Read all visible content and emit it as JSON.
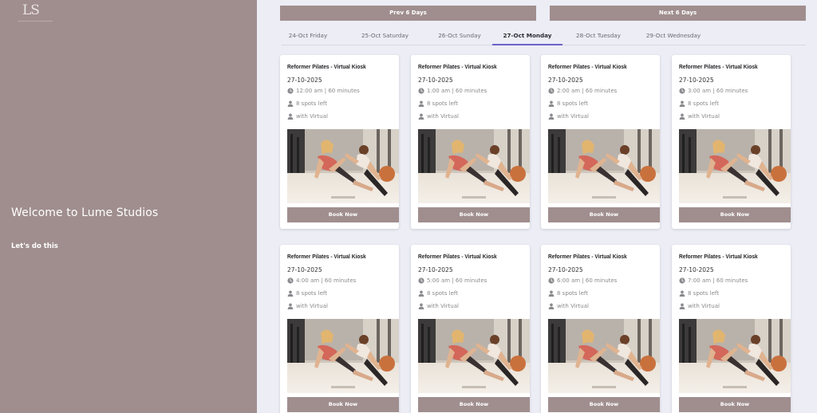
{
  "brand": {
    "logo_text": "LS"
  },
  "left": {
    "welcome": "Welcome to Lume Studios",
    "tagline": "Let's do this"
  },
  "nav": {
    "prev_label": "Prev 6 Days",
    "next_label": "Next 6 Days"
  },
  "tabs": [
    {
      "label": "24-Oct Friday",
      "active": false
    },
    {
      "label": "25-Oct Saturday",
      "active": false
    },
    {
      "label": "26-Oct Sunday",
      "active": false
    },
    {
      "label": "27-Oct Monday",
      "active": true
    },
    {
      "label": "28-Oct Tuesday",
      "active": false
    },
    {
      "label": "29-Oct Wednesday",
      "active": false
    }
  ],
  "classes": [
    {
      "title": "Reformer Pilates - Virtual Kiosk",
      "date": "27-10-2025",
      "time": "12:00 am | 60 minutes",
      "spots": "8 spots left",
      "instructor": "with Virtual",
      "button": "Book Now"
    },
    {
      "title": "Reformer Pilates - Virtual Kiosk",
      "date": "27-10-2025",
      "time": "1:00 am | 60 minutes",
      "spots": "8 spots left",
      "instructor": "with Virtual",
      "button": "Book Now"
    },
    {
      "title": "Reformer Pilates - Virtual Kiosk",
      "date": "27-10-2025",
      "time": "2:00 am | 60 minutes",
      "spots": "8 spots left",
      "instructor": "with Virtual",
      "button": "Book Now"
    },
    {
      "title": "Reformer Pilates - Virtual Kiosk",
      "date": "27-10-2025",
      "time": "3:00 am | 60 minutes",
      "spots": "8 spots left",
      "instructor": "with Virtual",
      "button": "Book Now"
    },
    {
      "title": "Reformer Pilates - Virtual Kiosk",
      "date": "27-10-2025",
      "time": "4:00 am | 60 minutes",
      "spots": "8 spots left",
      "instructor": "with Virtual",
      "button": "Book Now"
    },
    {
      "title": "Reformer Pilates - Virtual Kiosk",
      "date": "27-10-2025",
      "time": "5:00 am | 60 minutes",
      "spots": "8 spots left",
      "instructor": "with Virtual",
      "button": "Book Now"
    },
    {
      "title": "Reformer Pilates - Virtual Kiosk",
      "date": "27-10-2025",
      "time": "6:00 am | 60 minutes",
      "spots": "8 spots left",
      "instructor": "with Virtual",
      "button": "Book Now"
    },
    {
      "title": "Reformer Pilates - Virtual Kiosk",
      "date": "27-10-2025",
      "time": "7:00 am | 60 minutes",
      "spots": "8 spots left",
      "instructor": "with Virtual",
      "button": "Book Now"
    }
  ],
  "icons": {
    "time": "clock-icon",
    "spots": "person-icon",
    "instructor": "person-icon"
  },
  "colors": {
    "accent": "#a08e8e",
    "tab_underline": "#6a63c8",
    "background": "#ecedf5"
  }
}
